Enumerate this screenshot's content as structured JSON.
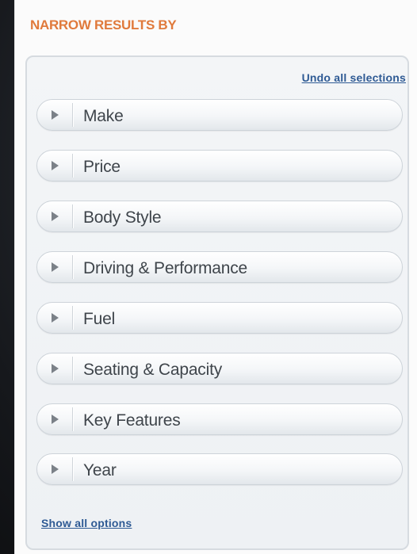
{
  "heading": "NARROW RESULTS BY",
  "undo_link": "Undo all selections",
  "show_all_link": "Show all options",
  "facets": [
    {
      "label": "Make"
    },
    {
      "label": "Price"
    },
    {
      "label": "Body Style"
    },
    {
      "label": "Driving & Performance"
    },
    {
      "label": "Fuel"
    },
    {
      "label": "Seating & Capacity"
    },
    {
      "label": "Key Features"
    },
    {
      "label": "Year"
    }
  ],
  "colors": {
    "heading": "#e07a3c",
    "link": "#2e5a94",
    "facet_text": "#3f454b",
    "background": "#121418"
  },
  "icons": {
    "facet_expand": "triangle-right-icon"
  }
}
